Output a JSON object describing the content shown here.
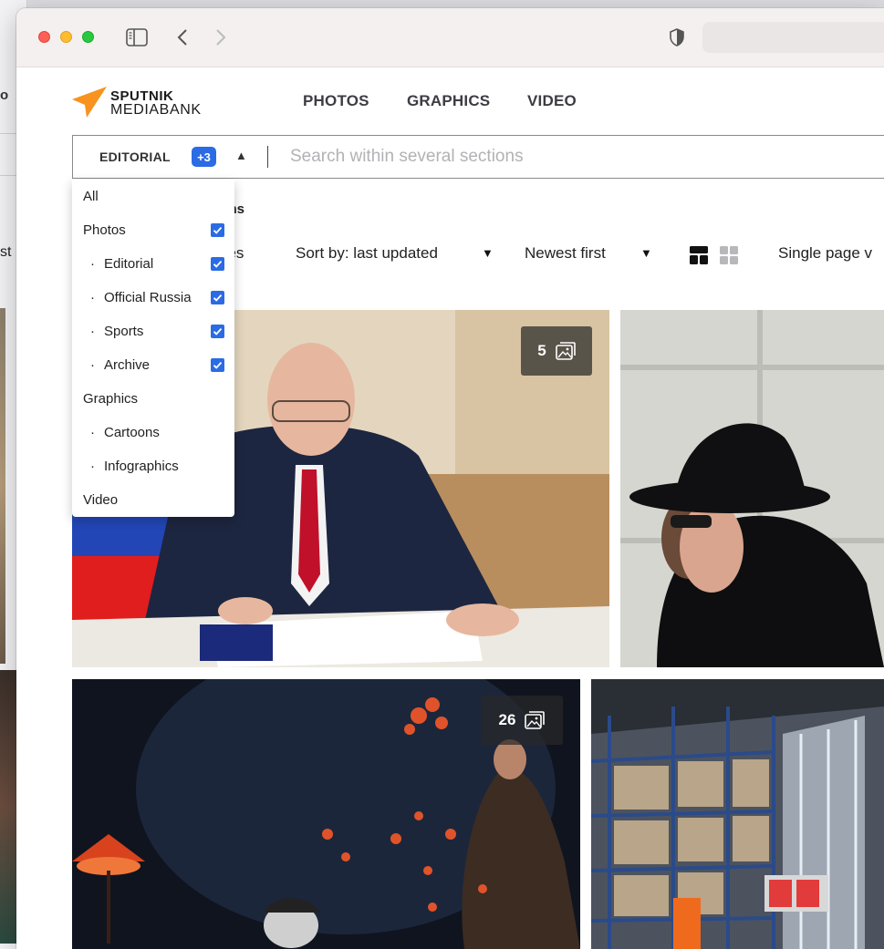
{
  "background_window": {
    "peek_text_1": "o",
    "peek_text_2": "st"
  },
  "browser": {
    "icons": {
      "sidebar": "sidebar-toggle-icon",
      "back": "chevron-left-icon",
      "forward": "chevron-right-icon",
      "privacy": "shield-icon"
    }
  },
  "site": {
    "logo_line1": "SPUTNIK",
    "logo_line2": "MEDIABANK",
    "brand_color": "#f7931e",
    "nav": [
      "PHOTOS",
      "GRAPHICS",
      "VIDEO"
    ]
  },
  "search": {
    "section_label": "EDITORIAL",
    "extra_count": "+3",
    "placeholder": "Search within several sections",
    "accent_color": "#2b6be4"
  },
  "dropdown": {
    "items": [
      {
        "label": "All",
        "level": 0,
        "checked": false
      },
      {
        "label": "Photos",
        "level": 0,
        "checked": true
      },
      {
        "label": "Editorial",
        "level": 1,
        "checked": true
      },
      {
        "label": "Official Russia",
        "level": 1,
        "checked": true
      },
      {
        "label": "Sports",
        "level": 1,
        "checked": true
      },
      {
        "label": "Archive",
        "level": 1,
        "checked": true
      },
      {
        "label": "Graphics",
        "level": 0,
        "checked": false
      },
      {
        "label": "Cartoons",
        "level": 1,
        "checked": false
      },
      {
        "label": "Infographics",
        "level": 1,
        "checked": false
      },
      {
        "label": "Video",
        "level": 0,
        "checked": false
      }
    ]
  },
  "results": {
    "items_text": "ems",
    "categories_text": "ries",
    "sort_label": "Sort by: last updated",
    "order_label": "Newest first",
    "view_mode_label": "Single page v"
  },
  "photos": [
    {
      "count": "5"
    },
    {
      "count": ""
    },
    {
      "count": "26"
    },
    {
      "count": ""
    }
  ]
}
